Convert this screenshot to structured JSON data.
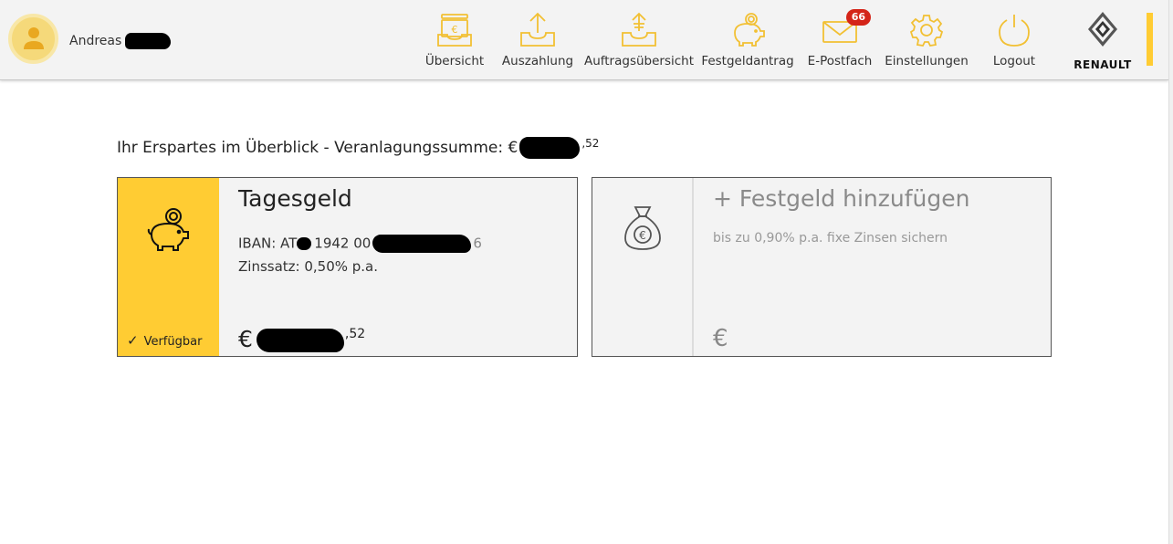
{
  "header": {
    "user_name": "Andreas",
    "nav": [
      {
        "label": "Übersicht",
        "icon": "inbox-euro-icon"
      },
      {
        "label": "Auszahlung",
        "icon": "upload-tray-icon"
      },
      {
        "label": "Auftragsübersicht",
        "icon": "upload-list-icon"
      },
      {
        "label": "Festgeldantrag",
        "icon": "piggy-bank-icon"
      },
      {
        "label": "E-Postfach",
        "icon": "envelope-icon",
        "badge": "66"
      },
      {
        "label": "Einstellungen",
        "icon": "gear-icon"
      },
      {
        "label": "Logout",
        "icon": "power-icon"
      }
    ],
    "brand": "RENAULT"
  },
  "summary": {
    "label": "Ihr Erspartes im Überblick - Veranlagungssumme: €",
    "cents": ",52"
  },
  "cards": {
    "tagesgeld": {
      "title": "Tagesgeld",
      "iban_prefix": "IBAN: AT",
      "iban_mid": "1942 00",
      "iban_suffix": "6",
      "rate": "Zinssatz: 0,50% p.a.",
      "status": "Verfügbar",
      "currency": "€",
      "cents": ",52"
    },
    "festgeld": {
      "title": "+ Festgeld hinzufügen",
      "subtitle": "bis zu 0,90% p.a. fixe Zinsen sichern",
      "currency": "€"
    }
  },
  "colors": {
    "accent": "#ffcc33",
    "icon": "#f2c033",
    "badge": "#d42418",
    "header_bg": "#f3f3f3",
    "card_bg": "#f3f3f3"
  }
}
